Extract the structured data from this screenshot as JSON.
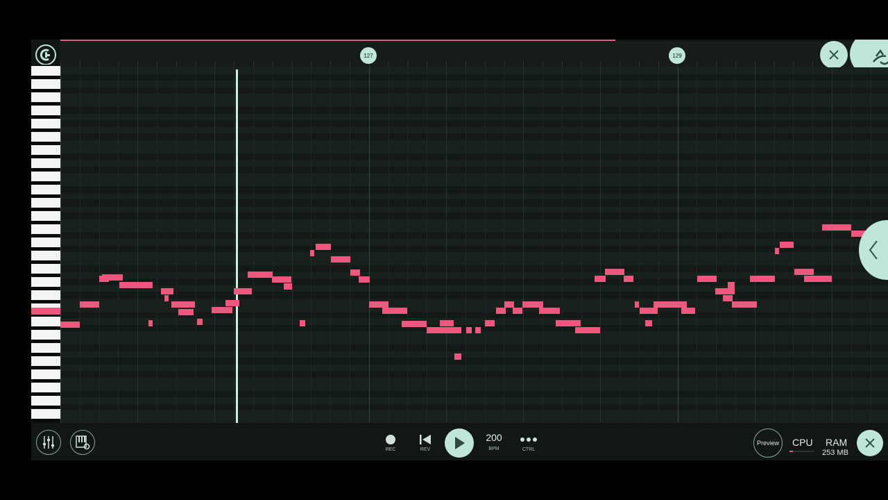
{
  "colors": {
    "accent": "#bfe6d7",
    "note": "#f0577f",
    "progress": "#f0577f",
    "background": "#161d1a"
  },
  "timeline": {
    "markers": [
      {
        "label": "127"
      },
      {
        "label": "129"
      }
    ]
  },
  "icons": {
    "logo": "fl-logo-icon",
    "close": "close-icon",
    "mascot": "fruit-mascot-icon",
    "mixer": "mixer-icon",
    "piano_settings": "piano-settings-icon",
    "record": "record-icon",
    "rewind": "rewind-icon",
    "play": "play-icon",
    "more": "more-icon",
    "collapse": "chevron-left-icon"
  },
  "transport": {
    "rec_label": "REC",
    "rev_label": "REV",
    "bpm_value": "200",
    "bpm_label": "BPM",
    "ctrl_label": "CTRL"
  },
  "status": {
    "preview_label": "Preview",
    "cpu_label": "CPU",
    "ram_label": "RAM",
    "ram_value": "253 MB"
  }
}
